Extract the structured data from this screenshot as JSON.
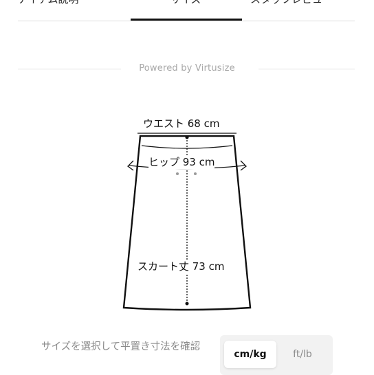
{
  "tabs": [
    {
      "label": "アイテム説明"
    },
    {
      "label": "サイズ"
    },
    {
      "label": "スタッフレビュー"
    }
  ],
  "powered_by": "Powered by Virtusize",
  "measurements": {
    "waist": "ウエスト 68 cm",
    "hip": "ヒップ 93 cm",
    "length": "スカート丈 73 cm"
  },
  "footer": {
    "instruction": "サイズを選択して平置き寸法を確認",
    "units": {
      "active": "cm/kg",
      "inactive": "ft/lb"
    }
  },
  "colors": {
    "accent": "#111111",
    "muted": "#8a8a8a"
  }
}
